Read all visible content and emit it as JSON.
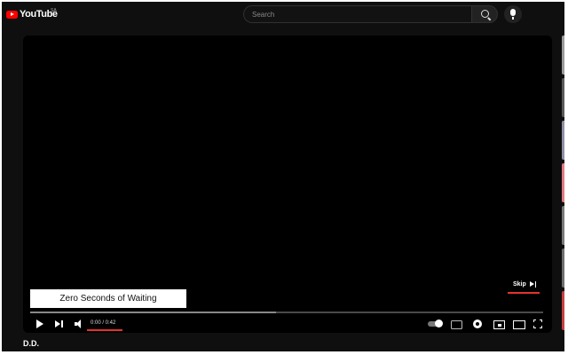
{
  "header": {
    "logo_text": "YouTube",
    "region": "SA",
    "search_placeholder": "Search"
  },
  "player": {
    "caption": "Zero Seconds of Waiting",
    "skip_label": "Skip",
    "time": "0:00 / 0:42",
    "progress_loaded": 0.48
  },
  "channel": {
    "name": "D.D."
  },
  "colors": {
    "brand": "#ff0000",
    "annotation_underline": "#e5322d",
    "background": "#0f0f0f"
  },
  "side_thumbnails": [
    {
      "color": "#9a9a9a"
    },
    {
      "color": "#5a5a5a"
    },
    {
      "color": "#8f8fa8"
    },
    {
      "color": "#e07a85"
    },
    {
      "color": "#7a7a7a"
    },
    {
      "color": "#6e6e6e"
    },
    {
      "color": "#c84040"
    }
  ]
}
